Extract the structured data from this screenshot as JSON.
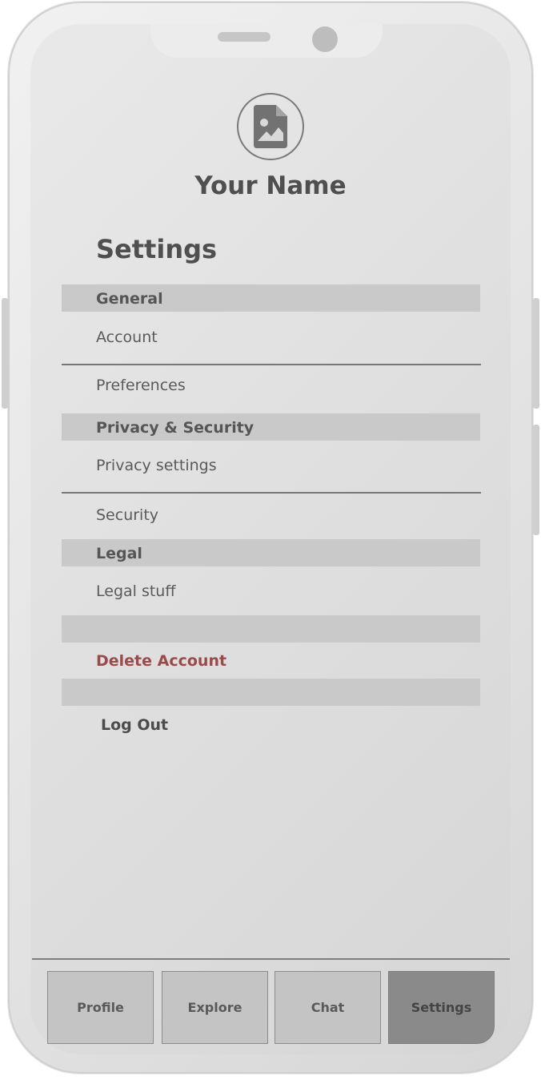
{
  "profile": {
    "name": "Your Name",
    "avatar_icon": "image-file-icon"
  },
  "page": {
    "title": "Settings"
  },
  "sections": [
    {
      "header": "General",
      "items": [
        "Account",
        "Preferences"
      ]
    },
    {
      "header": "Privacy & Security",
      "items": [
        "Privacy settings",
        "Security"
      ]
    },
    {
      "header": "Legal",
      "items": [
        "Legal stuff"
      ]
    }
  ],
  "actions": {
    "delete_account": "Delete Account",
    "log_out": "Log Out"
  },
  "tabs": [
    "Profile",
    "Explore",
    "Chat",
    "Settings"
  ],
  "active_tab": "Settings",
  "colors": {
    "danger": "#9b4a4a",
    "section_header": "#c9c9c9",
    "active_tab": "#8a8a8a"
  }
}
